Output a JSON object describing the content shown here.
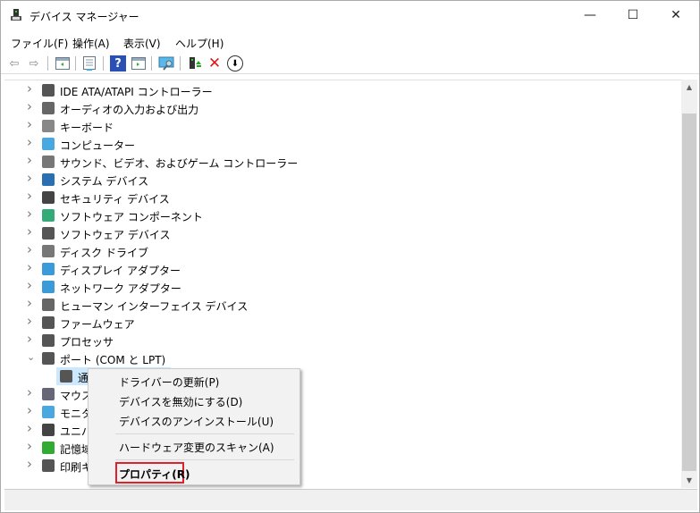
{
  "window": {
    "title": "デバイス マネージャー",
    "minimize": "—",
    "maximize": "☐",
    "close": "✕"
  },
  "menubar": [
    "ファイル(F)",
    "操作(A)",
    "表示(V)",
    "ヘルプ(H)"
  ],
  "toolbar": [
    "back-icon",
    "forward-icon",
    "show-hide-tree-icon",
    "properties-icon",
    "help-icon",
    "action-pane-icon",
    "scan-hardware-icon",
    "update-driver-icon",
    "uninstall-icon",
    "disable-icon"
  ],
  "tree": [
    {
      "label": "IDE ATA/ATAPI コントローラー",
      "expanded": false
    },
    {
      "label": "オーディオの入力および出力",
      "expanded": false
    },
    {
      "label": "キーボード",
      "expanded": false
    },
    {
      "label": "コンピューター",
      "expanded": false
    },
    {
      "label": "サウンド、ビデオ、およびゲーム コントローラー",
      "expanded": false
    },
    {
      "label": "システム デバイス",
      "expanded": false
    },
    {
      "label": "セキュリティ デバイス",
      "expanded": false
    },
    {
      "label": "ソフトウェア コンポーネント",
      "expanded": false
    },
    {
      "label": "ソフトウェア デバイス",
      "expanded": false
    },
    {
      "label": "ディスク ドライブ",
      "expanded": false
    },
    {
      "label": "ディスプレイ アダプター",
      "expanded": false
    },
    {
      "label": "ネットワーク アダプター",
      "expanded": false
    },
    {
      "label": "ヒューマン インターフェイス デバイス",
      "expanded": false
    },
    {
      "label": "ファームウェア",
      "expanded": false
    },
    {
      "label": "プロセッサ",
      "expanded": false
    },
    {
      "label": "ポート (COM と LPT)",
      "expanded": true
    },
    {
      "label": "通",
      "child": true,
      "selected": true
    },
    {
      "label": "マウス",
      "expanded": false
    },
    {
      "label": "モニタ",
      "expanded": false
    },
    {
      "label": "ユニバ",
      "expanded": false
    },
    {
      "label": "記憶域",
      "expanded": false
    },
    {
      "label": "印刷キ",
      "expanded": false
    }
  ],
  "context_menu": {
    "items": [
      "ドライバーの更新(P)",
      "デバイスを無効にする(D)",
      "デバイスのアンインストール(U)",
      "ハードウェア変更のスキャン(A)",
      "プロパティ(R)"
    ],
    "highlight_color": "#e0202a"
  }
}
